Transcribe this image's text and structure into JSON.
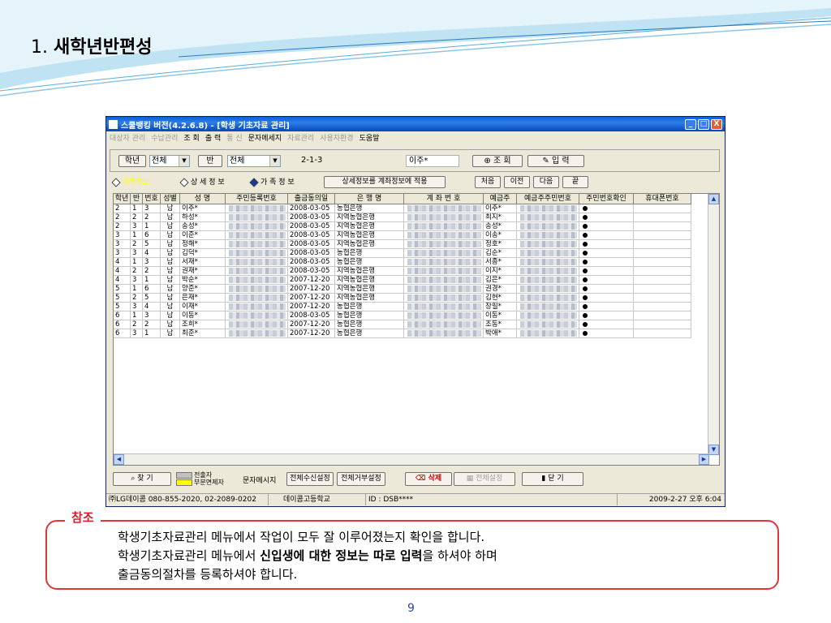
{
  "slide": {
    "title_number": "1.",
    "title_text": "새학년반편성",
    "page_number": "9"
  },
  "window": {
    "title": "스쿨뱅킹 버전(4.2.6.8) - [학생 기초자료 관리]",
    "controls": [
      "_",
      "□",
      "X"
    ]
  },
  "menu": [
    {
      "label": "대상자 관리",
      "enabled": false
    },
    {
      "label": "수납관리",
      "enabled": false
    },
    {
      "label": "조 회",
      "enabled": true
    },
    {
      "label": "출 력",
      "enabled": true
    },
    {
      "label": "통 신",
      "enabled": false
    },
    {
      "label": "문자메세지",
      "enabled": true
    },
    {
      "label": "자료관리",
      "enabled": false
    },
    {
      "label": "사용자환경",
      "enabled": false
    },
    {
      "label": "도움말",
      "enabled": true
    }
  ],
  "filter": {
    "grade_button": "학년",
    "grade_value": "전체",
    "class_button": "반",
    "class_value": "전체",
    "selected_class": "2-1-3",
    "selected_name": "이주*",
    "search_button": "조 회",
    "input_button": "입 력"
  },
  "tabs": {
    "tab1": "계좌정보",
    "tab2": "상 세 정 보",
    "tab3": "가 족 정 보",
    "apply_button": "상세정보를 계좌정보에 적용",
    "first": "처음",
    "prev": "이전",
    "next": "다음",
    "last": "끝"
  },
  "grid": {
    "columns": [
      "학년",
      "반",
      "번호",
      "성별",
      "성 명",
      "주민등록번호",
      "출금동의일",
      "은 행 명",
      "계 좌 번 호",
      "예금주",
      "예금주주민번호",
      "주민번호확인",
      "휴대폰번호"
    ],
    "rows": [
      {
        "grade": "2",
        "cls": "1",
        "no": "3",
        "sex": "남",
        "name": "이주*",
        "date": "2008-03-05",
        "bank": "농협은행",
        "holder": "이주*"
      },
      {
        "grade": "2",
        "cls": "2",
        "no": "2",
        "sex": "남",
        "name": "하성*",
        "date": "2008-03-05",
        "bank": "지역농협은행",
        "holder": "최지*"
      },
      {
        "grade": "2",
        "cls": "3",
        "no": "1",
        "sex": "남",
        "name": "송성*",
        "date": "2008-03-05",
        "bank": "지역농협은행",
        "holder": "송성*"
      },
      {
        "grade": "3",
        "cls": "1",
        "no": "6",
        "sex": "남",
        "name": "이준*",
        "date": "2008-03-05",
        "bank": "지역농협은행",
        "holder": "이송*"
      },
      {
        "grade": "3",
        "cls": "2",
        "no": "5",
        "sex": "남",
        "name": "정해*",
        "date": "2008-03-05",
        "bank": "지역농협은행",
        "holder": "정호*"
      },
      {
        "grade": "3",
        "cls": "3",
        "no": "4",
        "sex": "남",
        "name": "김덕*",
        "date": "2008-03-05",
        "bank": "농협은행",
        "holder": "김순*"
      },
      {
        "grade": "4",
        "cls": "1",
        "no": "3",
        "sex": "남",
        "name": "서재*",
        "date": "2008-03-05",
        "bank": "농협은행",
        "holder": "서종*"
      },
      {
        "grade": "4",
        "cls": "2",
        "no": "2",
        "sex": "남",
        "name": "권재*",
        "date": "2008-03-05",
        "bank": "지역농협은행",
        "holder": "이지*"
      },
      {
        "grade": "4",
        "cls": "3",
        "no": "1",
        "sex": "남",
        "name": "박순*",
        "date": "2007-12-20",
        "bank": "지역농협은행",
        "holder": "김은*"
      },
      {
        "grade": "5",
        "cls": "1",
        "no": "6",
        "sex": "남",
        "name": "양준*",
        "date": "2007-12-20",
        "bank": "지역농협은행",
        "holder": "권경*"
      },
      {
        "grade": "5",
        "cls": "2",
        "no": "5",
        "sex": "남",
        "name": "은재*",
        "date": "2007-12-20",
        "bank": "지역농협은행",
        "holder": "김현*"
      },
      {
        "grade": "5",
        "cls": "3",
        "no": "4",
        "sex": "남",
        "name": "이재*",
        "date": "2007-12-20",
        "bank": "농협은행",
        "holder": "장필*"
      },
      {
        "grade": "6",
        "cls": "1",
        "no": "3",
        "sex": "남",
        "name": "이동*",
        "date": "2008-03-05",
        "bank": "농협은행",
        "holder": "이동*"
      },
      {
        "grade": "6",
        "cls": "2",
        "no": "2",
        "sex": "남",
        "name": "조희*",
        "date": "2007-12-20",
        "bank": "농협은행",
        "holder": "조동*"
      },
      {
        "grade": "6",
        "cls": "3",
        "no": "1",
        "sex": "남",
        "name": "최준*",
        "date": "2007-12-20",
        "bank": "농협은행",
        "holder": "박애*"
      }
    ]
  },
  "bottom": {
    "find_button": "찾 기",
    "legend_transfer": "전출자",
    "legend_partial": "부분면제자",
    "legend_partial_color": "#ffff00",
    "sms_label": "문자메시지",
    "all_receive": "전체수신설정",
    "all_reject": "전체거부설정",
    "delete_button": "삭제",
    "all_settings": "전체설정",
    "close_button": "닫 기"
  },
  "status": {
    "company": "㈜LG데이콤 080-855-2020, 02-2089-0202",
    "school": "데이콤고등학교",
    "user_id": "ID : DSB****",
    "datetime": "2009-2-27 오후 6:04"
  },
  "note": {
    "label": "참조",
    "line1": "학생기초자료관리 메뉴에서 작업이 모두 잘 이루어졌는지 확인을 합니다.",
    "line2_a": "학생기초자료관리 메뉴에서 ",
    "line2_bold": "신입생에 대한 정보는 따로 입력",
    "line2_b": "을 하셔야 하며",
    "line3": "출금동의절차를 등록하셔야 합니다."
  },
  "colors": {
    "note_border": "#e2353a",
    "note_label": "#d81e2a",
    "delete_text": "#cc0000",
    "active_tab_text": "#ffff00",
    "page_number": "#2a4aa8"
  }
}
